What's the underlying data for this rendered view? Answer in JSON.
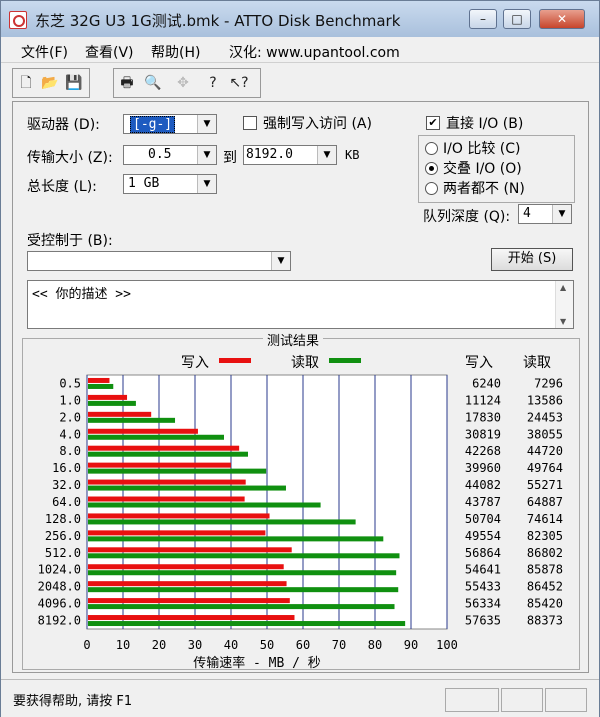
{
  "window": {
    "title": "东芝 32G U3 1G测试.bmk - ATTO Disk Benchmark",
    "minimize": "–",
    "maximize": "□",
    "close": "✕"
  },
  "menu": {
    "items": [
      "文件(F)",
      "查看(V)",
      "帮助(H)"
    ],
    "note": "汉化: www.upantool.com"
  },
  "toolbar": {
    "icons": [
      "new-icon",
      "open-icon",
      "save-icon",
      "print-icon",
      "print-preview-icon",
      "move-icon",
      "help-icon",
      "context-help-icon"
    ],
    "glyphs": [
      "🗋",
      "📂",
      "💾",
      "🖶",
      "🔍",
      "✥",
      "?",
      "↖?"
    ]
  },
  "form": {
    "drive_label": "驱动器 (D):",
    "drive_value": "[-g-]",
    "force_write_label": "强制写入访问 (A)",
    "force_write_checked": false,
    "direct_io_label": "直接 I/O (B)",
    "direct_io_checked": true,
    "transfer_label": "传输大小 (Z):",
    "transfer_from": "0.5",
    "to_label": "到",
    "transfer_to": "8192.0",
    "unit": "KB",
    "total_label": "总长度 (L):",
    "total_value": "1 GB",
    "io_compare_label": "I/O 比较 (C)",
    "io_overlap_label": "交叠 I/O (O)",
    "neither_label": "两者都不 (N)",
    "selected_mode": "交叠 I/O (O)",
    "queue_label": "队列深度 (Q):",
    "queue_value": "4",
    "controlled_label": "受控制于 (B):",
    "controlled_value": "",
    "start_button": "开始 (S)",
    "description": "<<  你的描述  >>"
  },
  "chart_data": {
    "type": "bar",
    "title": "测试结果",
    "xlabel": "传输速率 - MB / 秒",
    "xlim": [
      0,
      100
    ],
    "xticks": [
      0,
      10,
      20,
      30,
      40,
      50,
      60,
      70,
      80,
      90,
      100
    ],
    "categories": [
      "0.5",
      "1.0",
      "2.0",
      "4.0",
      "8.0",
      "16.0",
      "32.0",
      "64.0",
      "128.0",
      "256.0",
      "512.0",
      "1024.0",
      "2048.0",
      "4096.0",
      "8192.0"
    ],
    "series": [
      {
        "name": "写入",
        "color": "#e81010",
        "values": [
          6240,
          11124,
          17830,
          30819,
          42268,
          39960,
          44082,
          43787,
          50704,
          49554,
          56864,
          54641,
          55433,
          56334,
          57635
        ]
      },
      {
        "name": "读取",
        "color": "#109010",
        "values": [
          7296,
          13586,
          24453,
          38055,
          44720,
          49764,
          55271,
          64887,
          74614,
          82305,
          86802,
          85878,
          86452,
          85420,
          88373
        ]
      }
    ],
    "value_scale": "KB/s",
    "column_headers": [
      "写入",
      "读取"
    ]
  },
  "status": {
    "message": "要获得帮助, 请按 F1"
  }
}
